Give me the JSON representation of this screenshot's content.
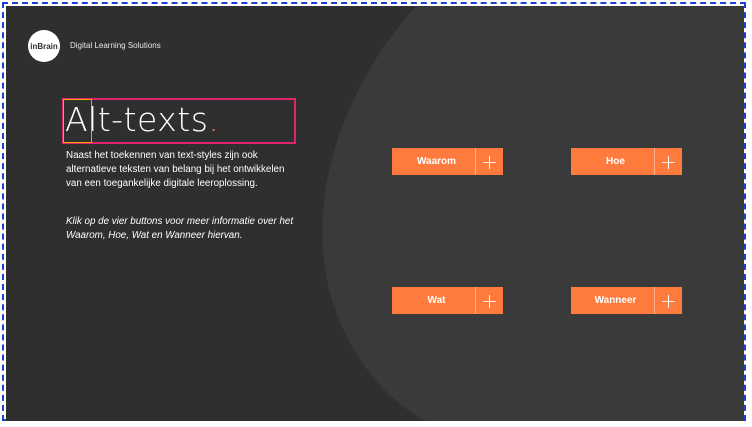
{
  "brand": {
    "logo_text": "inBrain",
    "tagline": "Digital Learning Solutions"
  },
  "slide": {
    "title_main": "Alt-texts",
    "title_dot": ".",
    "intro": "Naast het toekennen van text-styles zijn ook alternatieve teksten van belang bij het ontwikkelen van een toegankelijke digitale leeroplossing.",
    "instruction": "Klik op de vier buttons voor meer informatie over het Waarom, Hoe, Wat en Wanneer hiervan."
  },
  "buttons": [
    {
      "label": "Waarom",
      "icon": "plus-icon"
    },
    {
      "label": "Hoe",
      "icon": "plus-icon"
    },
    {
      "label": "Wat",
      "icon": "plus-icon"
    },
    {
      "label": "Wanneer",
      "icon": "plus-icon"
    }
  ],
  "colors": {
    "background": "#2f2f2f",
    "panel": "#3a3a3a",
    "accent": "#ff7a3d",
    "selection": "#e0246d",
    "frame": "#1a3fd6"
  }
}
